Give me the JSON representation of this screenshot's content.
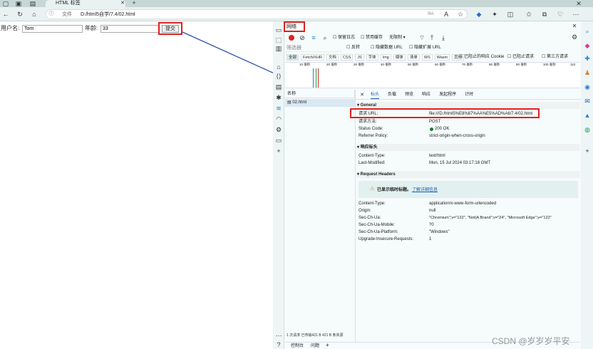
{
  "browser": {
    "tab_title": "HTML 标签",
    "url_prefix": "文件",
    "url": "D:/html5自学/7.4/02.html",
    "zoom_label": "ЯA"
  },
  "form": {
    "username_label": "用户名:",
    "username_value": "Tom",
    "age_label": "年龄:",
    "age_value": "33",
    "submit_label": "提交"
  },
  "devtools": {
    "panel_title": "网络",
    "toolbar": {
      "preserve_log": "保留日志",
      "disable_cache": "禁用缓存",
      "throttle": "无限制"
    },
    "filter": {
      "placeholder": "筛选器",
      "invert": "反转",
      "hide_data_urls": "隐藏数据 URL",
      "hide_ext_urls": "隐藏扩展 URL"
    },
    "types": [
      "全部",
      "Fetch/XHR",
      "文档",
      "CSS",
      "JS",
      "字体",
      "Img",
      "媒体",
      "清单",
      "WS",
      "Wasm",
      "其他"
    ],
    "blocked_cookies": "已阻止的响应 Cookie",
    "blocked_requests": "已阻止请求",
    "third_party": "第三方请求",
    "timeline_ticks": [
      "10 毫秒",
      "20 毫秒",
      "30 毫秒",
      "40 毫秒",
      "50 毫秒",
      "60 毫秒",
      "70 毫秒",
      "80 毫秒",
      "90 毫秒",
      "100 毫秒",
      "110"
    ],
    "list_header": "名称",
    "list_item": "02.html",
    "status_bar": "1 次请求  已传输421 B  421 B 条资源",
    "detail_tabs": [
      "标头",
      "负载",
      "预览",
      "响应",
      "发起程序",
      "计时"
    ],
    "general": {
      "title": "▾ General",
      "rows": [
        {
          "k": "请求 URL:",
          "v": "file:///D:/html5%E8%87%AA%E5%AD%A6/7.4/02.html"
        },
        {
          "k": "请求方法:",
          "v": "POST"
        },
        {
          "k": "Status Code:",
          "v": "200 OK"
        },
        {
          "k": "Referrer Policy:",
          "v": "strict-origin-when-cross-origin"
        }
      ]
    },
    "response_headers": {
      "title": "▾ 响应标头",
      "rows": [
        {
          "k": "Content-Type:",
          "v": "text/html"
        },
        {
          "k": "Last-Modified:",
          "v": "Mon, 15 Jul 2024 03:17:18 GMT"
        }
      ]
    },
    "request_headers": {
      "title": "▾ Request Headers",
      "warning": "已显示临时标题。",
      "warning_link": "了解详细信息",
      "rows": [
        {
          "k": "Content-Type:",
          "v": "application/x-www-form-urlencoded"
        },
        {
          "k": "Origin:",
          "v": "null"
        },
        {
          "k": "Sec-Ch-Ua:",
          "v": "\"Chromium\";v=\"122\", \"Not(A:Brand\";v=\"24\", \"Microsoft Edge\";v=\"122\""
        },
        {
          "k": "Sec-Ch-Ua-Mobile:",
          "v": "?0"
        },
        {
          "k": "Sec-Ch-Ua-Platform:",
          "v": "\"Windows\""
        },
        {
          "k": "Upgrade-Insecure-Requests:",
          "v": "1"
        }
      ]
    },
    "bottom_tabs": [
      "控制台",
      "问题"
    ]
  },
  "watermark": "CSDN @岁岁岁平安",
  "colors": {
    "accent": "#7fc9c5",
    "red": "#e02020",
    "arrow": "#2f4fb0",
    "status_ok": "#1f7a3a"
  }
}
